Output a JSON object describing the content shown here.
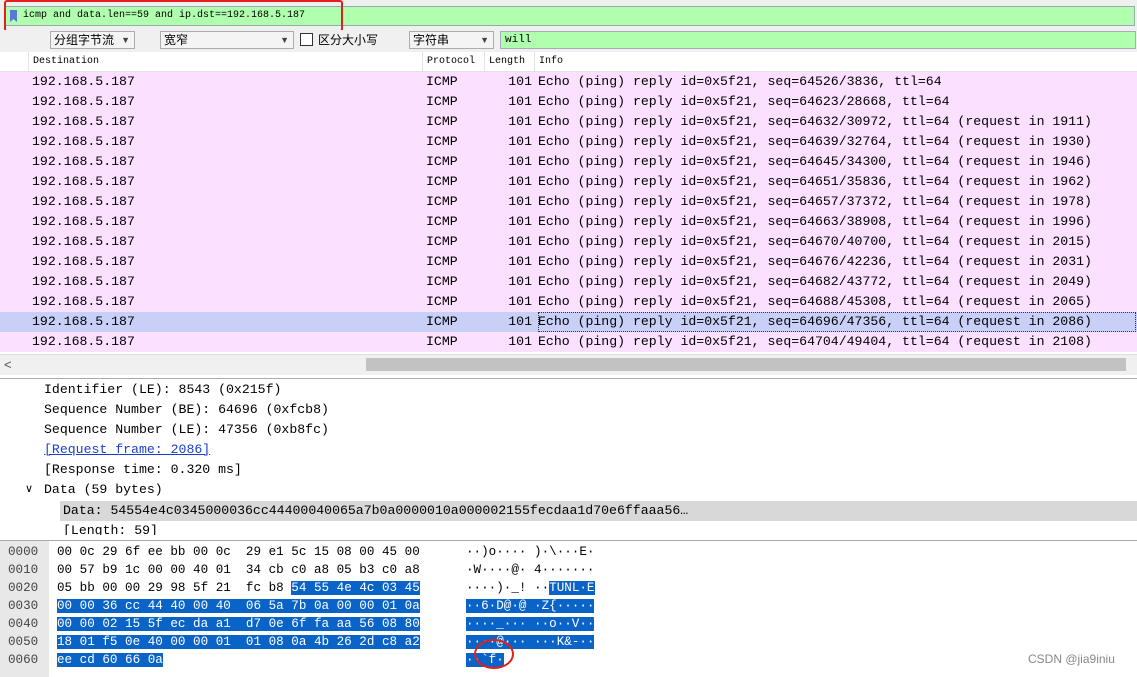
{
  "filter": {
    "text": "icmp and data.len==59 and ip.dst==192.168.5.187"
  },
  "search": {
    "scope": "分组字节流",
    "char_width": "宽窄",
    "case_label": "区分大小写",
    "type": "字符串",
    "query": "will"
  },
  "columns": {
    "destination": "Destination",
    "protocol": "Protocol",
    "length": "Length",
    "info": "Info"
  },
  "packets": [
    {
      "dst": "192.168.5.187",
      "proto": "ICMP",
      "len": "101",
      "info": "Echo (ping) reply    id=0x5f21, seq=64526/3836, ttl=64"
    },
    {
      "dst": "192.168.5.187",
      "proto": "ICMP",
      "len": "101",
      "info": "Echo (ping) reply    id=0x5f21, seq=64623/28668, ttl=64"
    },
    {
      "dst": "192.168.5.187",
      "proto": "ICMP",
      "len": "101",
      "info": "Echo (ping) reply    id=0x5f21, seq=64632/30972, ttl=64 (request in 1911)"
    },
    {
      "dst": "192.168.5.187",
      "proto": "ICMP",
      "len": "101",
      "info": "Echo (ping) reply    id=0x5f21, seq=64639/32764, ttl=64 (request in 1930)"
    },
    {
      "dst": "192.168.5.187",
      "proto": "ICMP",
      "len": "101",
      "info": "Echo (ping) reply    id=0x5f21, seq=64645/34300, ttl=64 (request in 1946)"
    },
    {
      "dst": "192.168.5.187",
      "proto": "ICMP",
      "len": "101",
      "info": "Echo (ping) reply    id=0x5f21, seq=64651/35836, ttl=64 (request in 1962)"
    },
    {
      "dst": "192.168.5.187",
      "proto": "ICMP",
      "len": "101",
      "info": "Echo (ping) reply    id=0x5f21, seq=64657/37372, ttl=64 (request in 1978)"
    },
    {
      "dst": "192.168.5.187",
      "proto": "ICMP",
      "len": "101",
      "info": "Echo (ping) reply    id=0x5f21, seq=64663/38908, ttl=64 (request in 1996)"
    },
    {
      "dst": "192.168.5.187",
      "proto": "ICMP",
      "len": "101",
      "info": "Echo (ping) reply    id=0x5f21, seq=64670/40700, ttl=64 (request in 2015)"
    },
    {
      "dst": "192.168.5.187",
      "proto": "ICMP",
      "len": "101",
      "info": "Echo (ping) reply    id=0x5f21, seq=64676/42236, ttl=64 (request in 2031)"
    },
    {
      "dst": "192.168.5.187",
      "proto": "ICMP",
      "len": "101",
      "info": "Echo (ping) reply    id=0x5f21, seq=64682/43772, ttl=64 (request in 2049)"
    },
    {
      "dst": "192.168.5.187",
      "proto": "ICMP",
      "len": "101",
      "info": "Echo (ping) reply    id=0x5f21, seq=64688/45308, ttl=64 (request in 2065)"
    },
    {
      "dst": "192.168.5.187",
      "proto": "ICMP",
      "len": "101",
      "info": "Echo (ping) reply    id=0x5f21, seq=64696/47356, ttl=64 (request in 2086)",
      "selected": true
    },
    {
      "dst": "192.168.5.187",
      "proto": "ICMP",
      "len": "101",
      "info": "Echo (ping) reply    id=0x5f21, seq=64704/49404, ttl=64 (request in 2108)"
    }
  ],
  "details": {
    "identifier": "Identifier (LE): 8543 (0x215f)",
    "seq_be": "Sequence Number (BE): 64696 (0xfcb8)",
    "seq_le": "Sequence Number (LE): 47356 (0xb8fc)",
    "request_frame": "[Request frame: 2086]",
    "response_time": "[Response time: 0.320 ms]",
    "data_toggle": "∨",
    "data_header": "Data (59 bytes)",
    "data_value": "Data: 54554e4c0345000036cc44400040065a7b0a0000010a000002155fecdaa1d70e6ffaaa56…",
    "length": "[Length: 59]"
  },
  "bytes": [
    {
      "offset": "0000",
      "hex": [
        "00 0c 29 6f ee bb 00 0c  29 e1 5c 15 08 00 45 00",
        ""
      ],
      "ascii": [
        "··)o···· )·\\···E·",
        ""
      ]
    },
    {
      "offset": "0010",
      "hex": [
        "00 57 b9 1c 00 00 40 01  34 cb c0 a8 05 b3 c0 a8",
        ""
      ],
      "ascii": [
        "·W····@· 4·······",
        ""
      ]
    },
    {
      "offset": "0020",
      "hex": [
        "05 bb 00 00 29 98 5f 21  fc b8 ",
        "54 55 4e 4c 03 45"
      ],
      "ascii": [
        "····)·_! ··",
        "TUNL·E"
      ]
    },
    {
      "offset": "0030",
      "hex": [
        "",
        "00 00 36 cc 44 40 00 40  06 5a 7b 0a 00 00 01 0a"
      ],
      "ascii": [
        "",
        "··6·D@·@ ·Z{·····"
      ]
    },
    {
      "offset": "0040",
      "hex": [
        "",
        "00 00 02 15 5f ec da a1  d7 0e 6f fa aa 56 08 80"
      ],
      "ascii": [
        "",
        "····_··· ··o··V··"
      ]
    },
    {
      "offset": "0050",
      "hex": [
        "",
        "18 01 f5 0e 40 00 00 01  01 08 0a 4b 26 2d c8 a2"
      ],
      "ascii": [
        "",
        "····@··· ···K&-··"
      ]
    },
    {
      "offset": "0060",
      "hex": [
        "",
        "ee cd 60 66 0a"
      ],
      "ascii": [
        "",
        "··`f·"
      ]
    }
  ],
  "watermark": "CSDN @jia9iniu"
}
